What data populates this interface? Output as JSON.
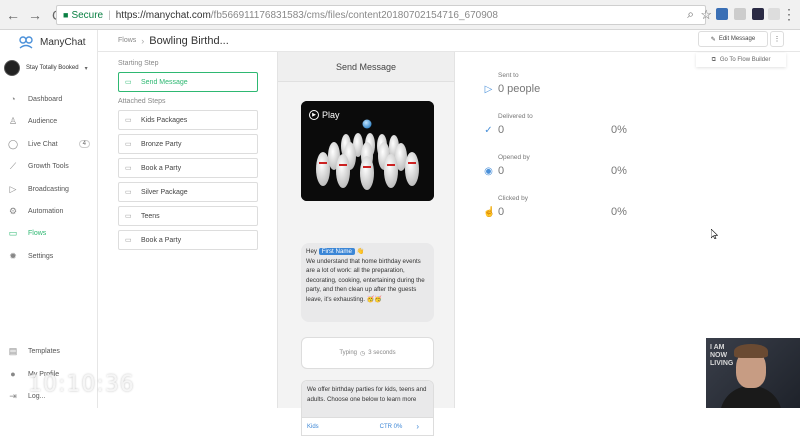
{
  "browser": {
    "secure_label": "Secure",
    "url_host": "https://manychat.com",
    "url_path": "/fb566911176831583/cms/files/content20180702154716_670908"
  },
  "app": {
    "name": "ManyChat",
    "page_name": "Stay Totally Booked"
  },
  "sidebar": {
    "items": [
      {
        "label": "Dashboard",
        "icon": "dashboard-icon"
      },
      {
        "label": "Audience",
        "icon": "user-icon"
      },
      {
        "label": "Live Chat",
        "icon": "chat-icon",
        "badge": "4"
      },
      {
        "label": "Growth Tools",
        "icon": "growth-icon"
      },
      {
        "label": "Broadcasting",
        "icon": "send-icon"
      },
      {
        "label": "Automation",
        "icon": "automation-icon"
      },
      {
        "label": "Flows",
        "icon": "folder-icon",
        "active": true
      },
      {
        "label": "Settings",
        "icon": "gear-icon"
      }
    ],
    "bottom_items": [
      {
        "label": "Templates",
        "icon": "templates-icon"
      },
      {
        "label": "My Profile",
        "icon": "profile-icon"
      },
      {
        "label": "Log...",
        "icon": "logout-icon"
      }
    ]
  },
  "header": {
    "breadcrumb": "Flows",
    "flow_title": "Bowling Birthd...",
    "edit_label": "Edit Message",
    "more_label": "⋮",
    "goto_label": "Go To Flow Builder"
  },
  "steps": {
    "starting_label": "Starting Step",
    "starting_step": "Send Message",
    "attached_label": "Attached Steps",
    "attached": [
      "Kids Packages",
      "Bronze Party",
      "Book a Party",
      "Silver Package",
      "Teens",
      "Book a Party"
    ]
  },
  "preview": {
    "title": "Send Message",
    "play_label": "Play",
    "bubble_hey": "Hey",
    "first_name_chip": "First Name",
    "bubble_emoji": "👋",
    "bubble_text": "We understand that home birthday events are a lot of work: all the preparation, decorating, cooking, entertaining during the party, and then clean up after the guests leave, it's exhausting. 🥳🥳",
    "typing_label": "Typing",
    "typing_duration": "3 seconds",
    "card_text": "We offer birthday parties for kids, teens and adults.  Choose one below to learn more",
    "card_button_label": "Kids",
    "card_button_ctr": "CTR 0%",
    "card_button_arrow": "›"
  },
  "stats": [
    {
      "label": "Sent to",
      "value": "0 people",
      "icon": "send-icon"
    },
    {
      "label": "Delivered to",
      "value": "0",
      "pct": "0%",
      "icon": "check-circle-icon"
    },
    {
      "label": "Opened by",
      "value": "0",
      "pct": "0%",
      "icon": "eye-icon"
    },
    {
      "label": "Clicked by",
      "value": "0",
      "pct": "0%",
      "icon": "click-icon"
    }
  ],
  "overlay": {
    "timestamp": "10:10:36",
    "webcam_sign": "I AM\nNOW\nLIVING"
  },
  "colors": {
    "accent_green": "#2eb872",
    "accent_blue": "#3b86d6"
  }
}
